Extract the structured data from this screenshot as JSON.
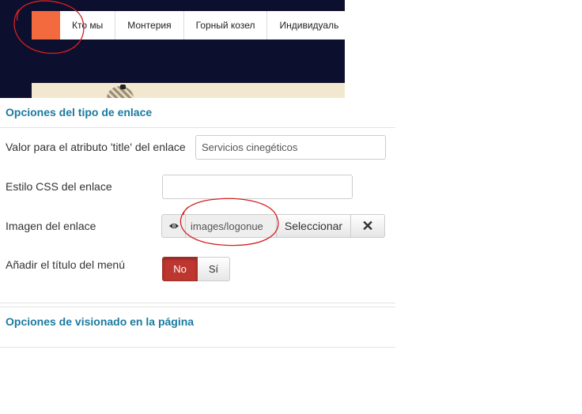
{
  "preview": {
    "nav_items": [
      "Кто мы",
      "Монтерия",
      "Горный козел",
      "Индивидуаль"
    ],
    "colors": {
      "header_bg": "#0d0f2e",
      "logo": "#f26a3d"
    }
  },
  "link_type_section": {
    "title": "Opciones del tipo de enlace"
  },
  "title_attr": {
    "label": "Valor para el atributo 'title' del enlace",
    "value": "Servicios cinegéticos"
  },
  "css_style": {
    "label": "Estilo CSS del enlace",
    "value": ""
  },
  "link_image": {
    "label": "Imagen del enlace",
    "path": "images/logonue",
    "preview_icon": "eye-icon",
    "select_label": "Seleccionar",
    "clear_icon": "close-icon"
  },
  "add_menu_title": {
    "label": "Añadir el título del menú",
    "no_label": "No",
    "yes_label": "Sí",
    "selected": "No"
  },
  "display_section": {
    "title": "Opciones de visionado en la página"
  },
  "accent_colors": {
    "section_title": "#1a7aa0",
    "toggle_active": "#bd362f",
    "annotation": "#d62020"
  }
}
